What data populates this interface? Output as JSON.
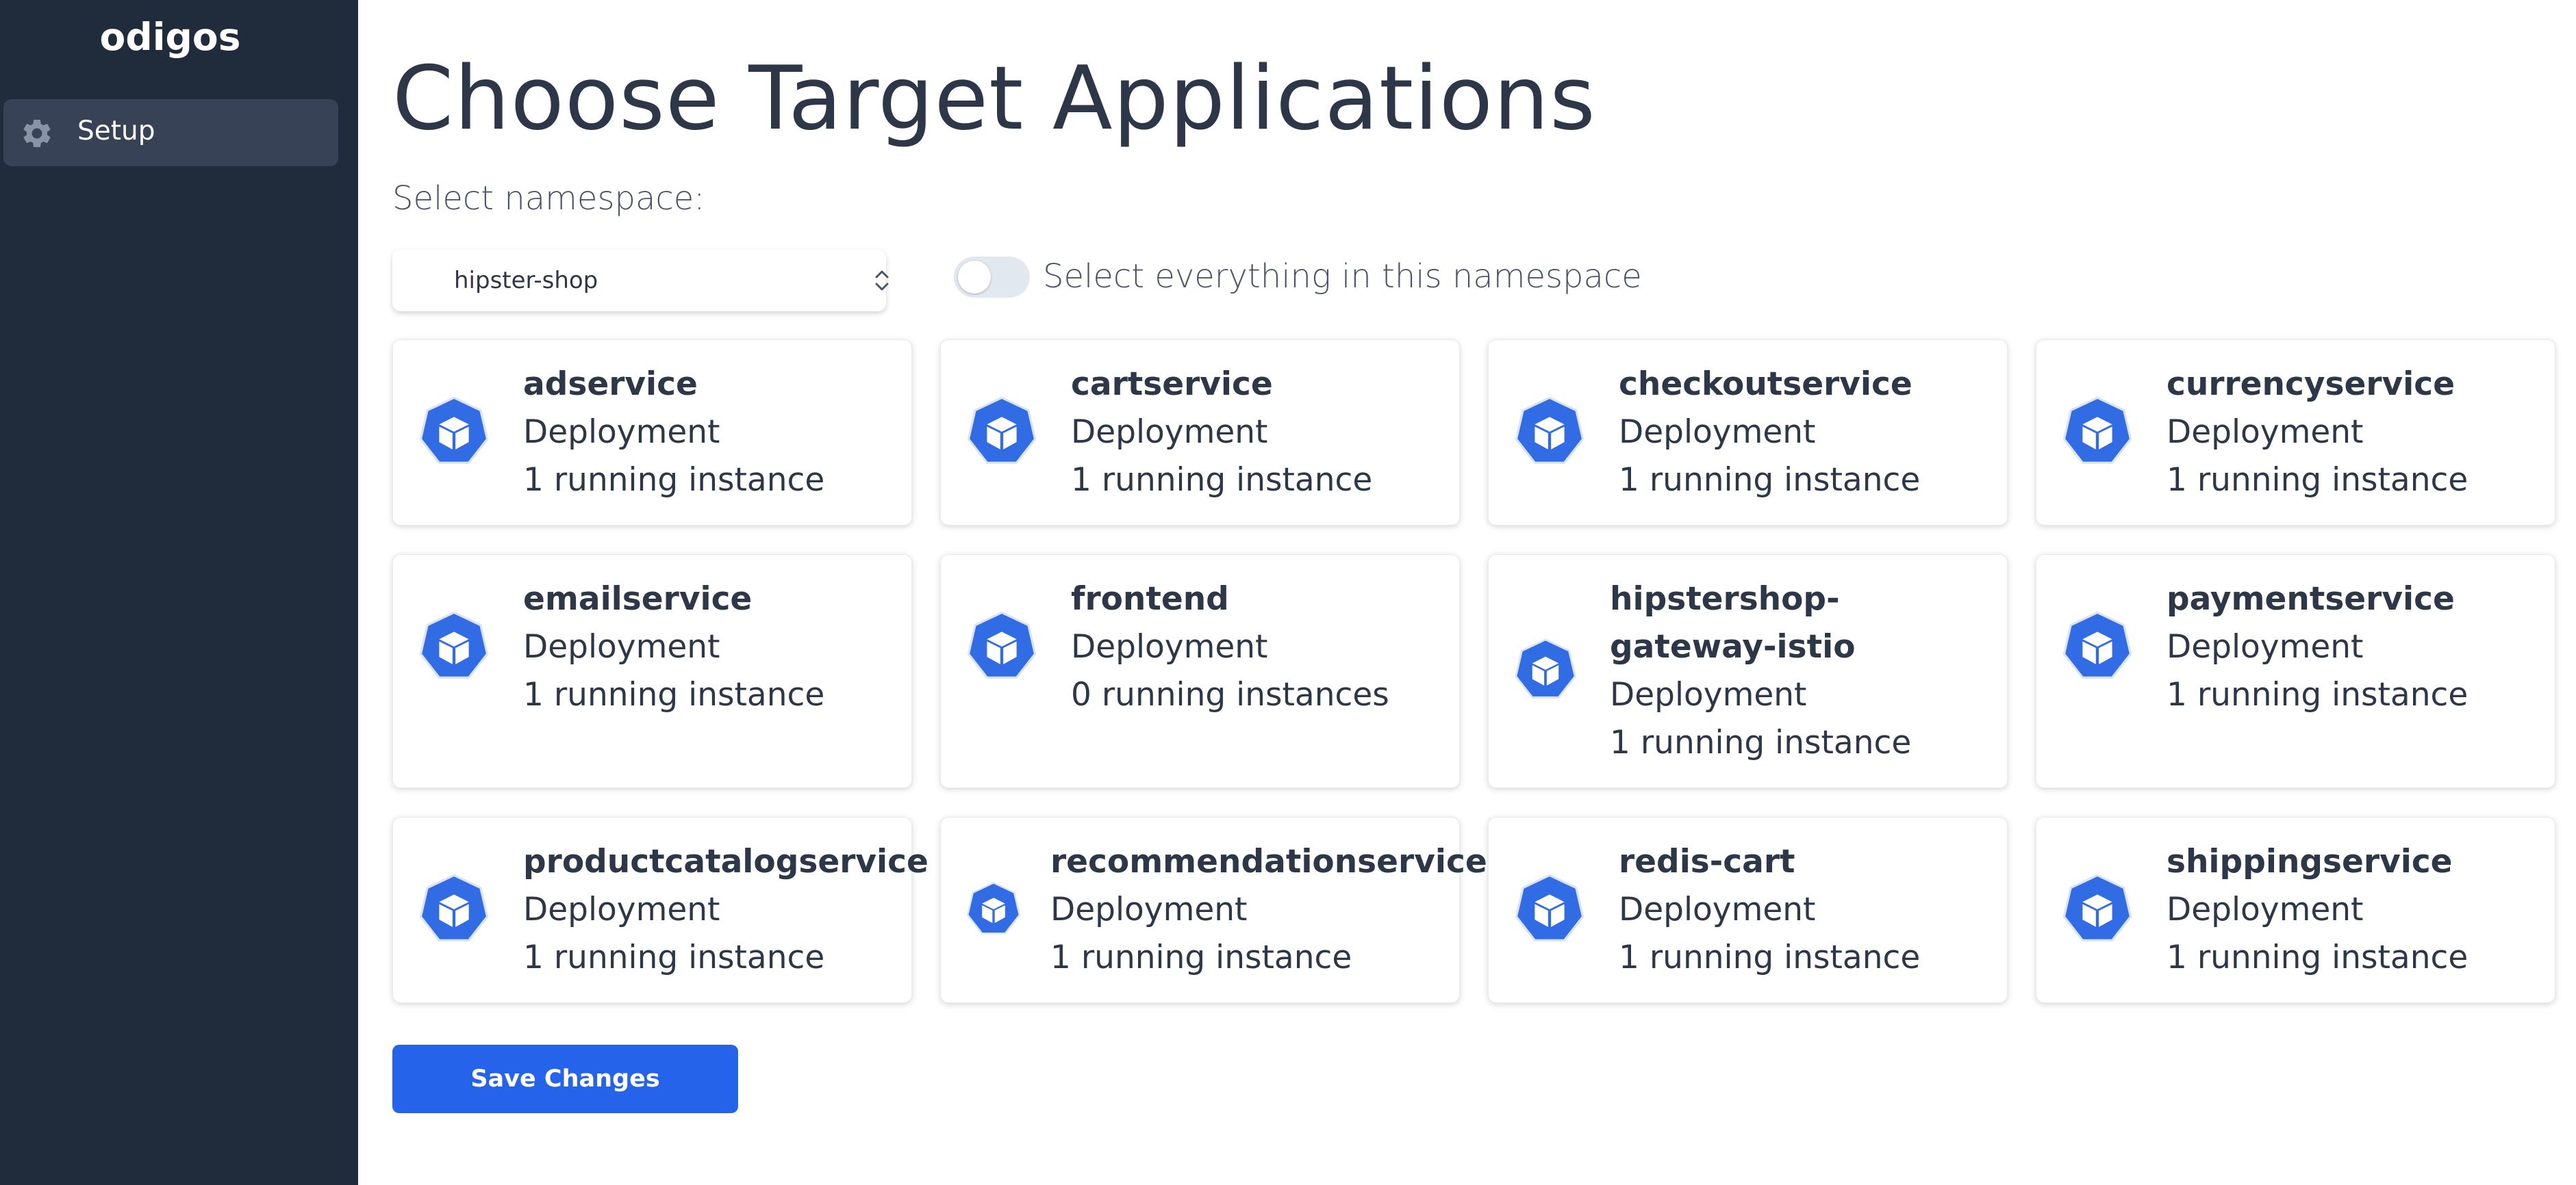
{
  "app": {
    "brand": "odigos"
  },
  "sidebar": {
    "items": [
      {
        "label": "Setup",
        "icon": "gear-icon"
      }
    ]
  },
  "page": {
    "title": "Choose Target Applications",
    "namespace_label": "Select namespace:",
    "namespace_value": "hipster-shop",
    "select_all_label": "Select everything in this namespace",
    "select_all_enabled": false,
    "save_label": "Save Changes"
  },
  "colors": {
    "sidebar_bg": "#202b3c",
    "accent": "#2563eb",
    "icon": "#326ce5"
  },
  "apps": [
    {
      "name": "adservice",
      "kind": "Deployment",
      "instances": "1 running instance"
    },
    {
      "name": "cartservice",
      "kind": "Deployment",
      "instances": "1 running instance"
    },
    {
      "name": "checkoutservice",
      "kind": "Deployment",
      "instances": "1 running instance"
    },
    {
      "name": "currencyservice",
      "kind": "Deployment",
      "instances": "1 running instance"
    },
    {
      "name": "emailservice",
      "kind": "Deployment",
      "instances": "1 running instance"
    },
    {
      "name": "frontend",
      "kind": "Deployment",
      "instances": "0 running instances"
    },
    {
      "name": "hipstershop-gateway-istio",
      "kind": "Deployment",
      "instances": "1 running instance"
    },
    {
      "name": "paymentservice",
      "kind": "Deployment",
      "instances": "1 running instance"
    },
    {
      "name": "productcatalogservice",
      "kind": "Deployment",
      "instances": "1 running instance"
    },
    {
      "name": "recommendationservice",
      "kind": "Deployment",
      "instances": "1 running instance"
    },
    {
      "name": "redis-cart",
      "kind": "Deployment",
      "instances": "1 running instance"
    },
    {
      "name": "shippingservice",
      "kind": "Deployment",
      "instances": "1 running instance"
    }
  ]
}
